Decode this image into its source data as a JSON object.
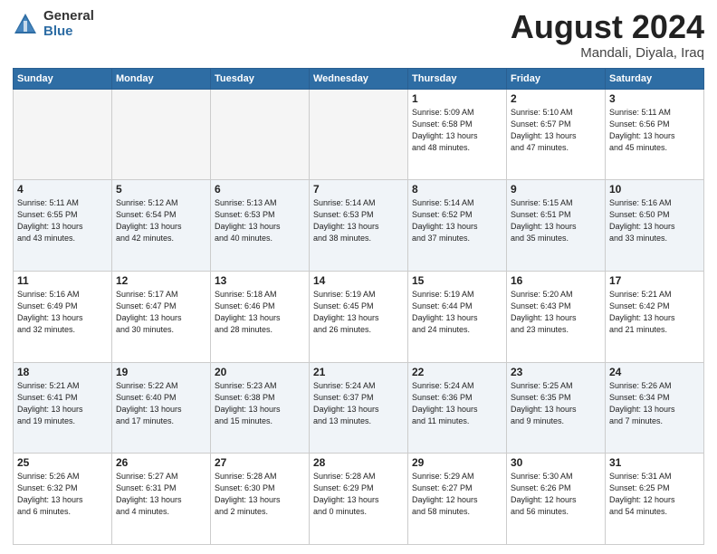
{
  "logo": {
    "general": "General",
    "blue": "Blue"
  },
  "title": {
    "month": "August 2024",
    "location": "Mandali, Diyala, Iraq"
  },
  "weekdays": [
    "Sunday",
    "Monday",
    "Tuesday",
    "Wednesday",
    "Thursday",
    "Friday",
    "Saturday"
  ],
  "weeks": [
    [
      {
        "day": "",
        "info": ""
      },
      {
        "day": "",
        "info": ""
      },
      {
        "day": "",
        "info": ""
      },
      {
        "day": "",
        "info": ""
      },
      {
        "day": "1",
        "info": "Sunrise: 5:09 AM\nSunset: 6:58 PM\nDaylight: 13 hours\nand 48 minutes."
      },
      {
        "day": "2",
        "info": "Sunrise: 5:10 AM\nSunset: 6:57 PM\nDaylight: 13 hours\nand 47 minutes."
      },
      {
        "day": "3",
        "info": "Sunrise: 5:11 AM\nSunset: 6:56 PM\nDaylight: 13 hours\nand 45 minutes."
      }
    ],
    [
      {
        "day": "4",
        "info": "Sunrise: 5:11 AM\nSunset: 6:55 PM\nDaylight: 13 hours\nand 43 minutes."
      },
      {
        "day": "5",
        "info": "Sunrise: 5:12 AM\nSunset: 6:54 PM\nDaylight: 13 hours\nand 42 minutes."
      },
      {
        "day": "6",
        "info": "Sunrise: 5:13 AM\nSunset: 6:53 PM\nDaylight: 13 hours\nand 40 minutes."
      },
      {
        "day": "7",
        "info": "Sunrise: 5:14 AM\nSunset: 6:53 PM\nDaylight: 13 hours\nand 38 minutes."
      },
      {
        "day": "8",
        "info": "Sunrise: 5:14 AM\nSunset: 6:52 PM\nDaylight: 13 hours\nand 37 minutes."
      },
      {
        "day": "9",
        "info": "Sunrise: 5:15 AM\nSunset: 6:51 PM\nDaylight: 13 hours\nand 35 minutes."
      },
      {
        "day": "10",
        "info": "Sunrise: 5:16 AM\nSunset: 6:50 PM\nDaylight: 13 hours\nand 33 minutes."
      }
    ],
    [
      {
        "day": "11",
        "info": "Sunrise: 5:16 AM\nSunset: 6:49 PM\nDaylight: 13 hours\nand 32 minutes."
      },
      {
        "day": "12",
        "info": "Sunrise: 5:17 AM\nSunset: 6:47 PM\nDaylight: 13 hours\nand 30 minutes."
      },
      {
        "day": "13",
        "info": "Sunrise: 5:18 AM\nSunset: 6:46 PM\nDaylight: 13 hours\nand 28 minutes."
      },
      {
        "day": "14",
        "info": "Sunrise: 5:19 AM\nSunset: 6:45 PM\nDaylight: 13 hours\nand 26 minutes."
      },
      {
        "day": "15",
        "info": "Sunrise: 5:19 AM\nSunset: 6:44 PM\nDaylight: 13 hours\nand 24 minutes."
      },
      {
        "day": "16",
        "info": "Sunrise: 5:20 AM\nSunset: 6:43 PM\nDaylight: 13 hours\nand 23 minutes."
      },
      {
        "day": "17",
        "info": "Sunrise: 5:21 AM\nSunset: 6:42 PM\nDaylight: 13 hours\nand 21 minutes."
      }
    ],
    [
      {
        "day": "18",
        "info": "Sunrise: 5:21 AM\nSunset: 6:41 PM\nDaylight: 13 hours\nand 19 minutes."
      },
      {
        "day": "19",
        "info": "Sunrise: 5:22 AM\nSunset: 6:40 PM\nDaylight: 13 hours\nand 17 minutes."
      },
      {
        "day": "20",
        "info": "Sunrise: 5:23 AM\nSunset: 6:38 PM\nDaylight: 13 hours\nand 15 minutes."
      },
      {
        "day": "21",
        "info": "Sunrise: 5:24 AM\nSunset: 6:37 PM\nDaylight: 13 hours\nand 13 minutes."
      },
      {
        "day": "22",
        "info": "Sunrise: 5:24 AM\nSunset: 6:36 PM\nDaylight: 13 hours\nand 11 minutes."
      },
      {
        "day": "23",
        "info": "Sunrise: 5:25 AM\nSunset: 6:35 PM\nDaylight: 13 hours\nand 9 minutes."
      },
      {
        "day": "24",
        "info": "Sunrise: 5:26 AM\nSunset: 6:34 PM\nDaylight: 13 hours\nand 7 minutes."
      }
    ],
    [
      {
        "day": "25",
        "info": "Sunrise: 5:26 AM\nSunset: 6:32 PM\nDaylight: 13 hours\nand 6 minutes."
      },
      {
        "day": "26",
        "info": "Sunrise: 5:27 AM\nSunset: 6:31 PM\nDaylight: 13 hours\nand 4 minutes."
      },
      {
        "day": "27",
        "info": "Sunrise: 5:28 AM\nSunset: 6:30 PM\nDaylight: 13 hours\nand 2 minutes."
      },
      {
        "day": "28",
        "info": "Sunrise: 5:28 AM\nSunset: 6:29 PM\nDaylight: 13 hours\nand 0 minutes."
      },
      {
        "day": "29",
        "info": "Sunrise: 5:29 AM\nSunset: 6:27 PM\nDaylight: 12 hours\nand 58 minutes."
      },
      {
        "day": "30",
        "info": "Sunrise: 5:30 AM\nSunset: 6:26 PM\nDaylight: 12 hours\nand 56 minutes."
      },
      {
        "day": "31",
        "info": "Sunrise: 5:31 AM\nSunset: 6:25 PM\nDaylight: 12 hours\nand 54 minutes."
      }
    ]
  ]
}
